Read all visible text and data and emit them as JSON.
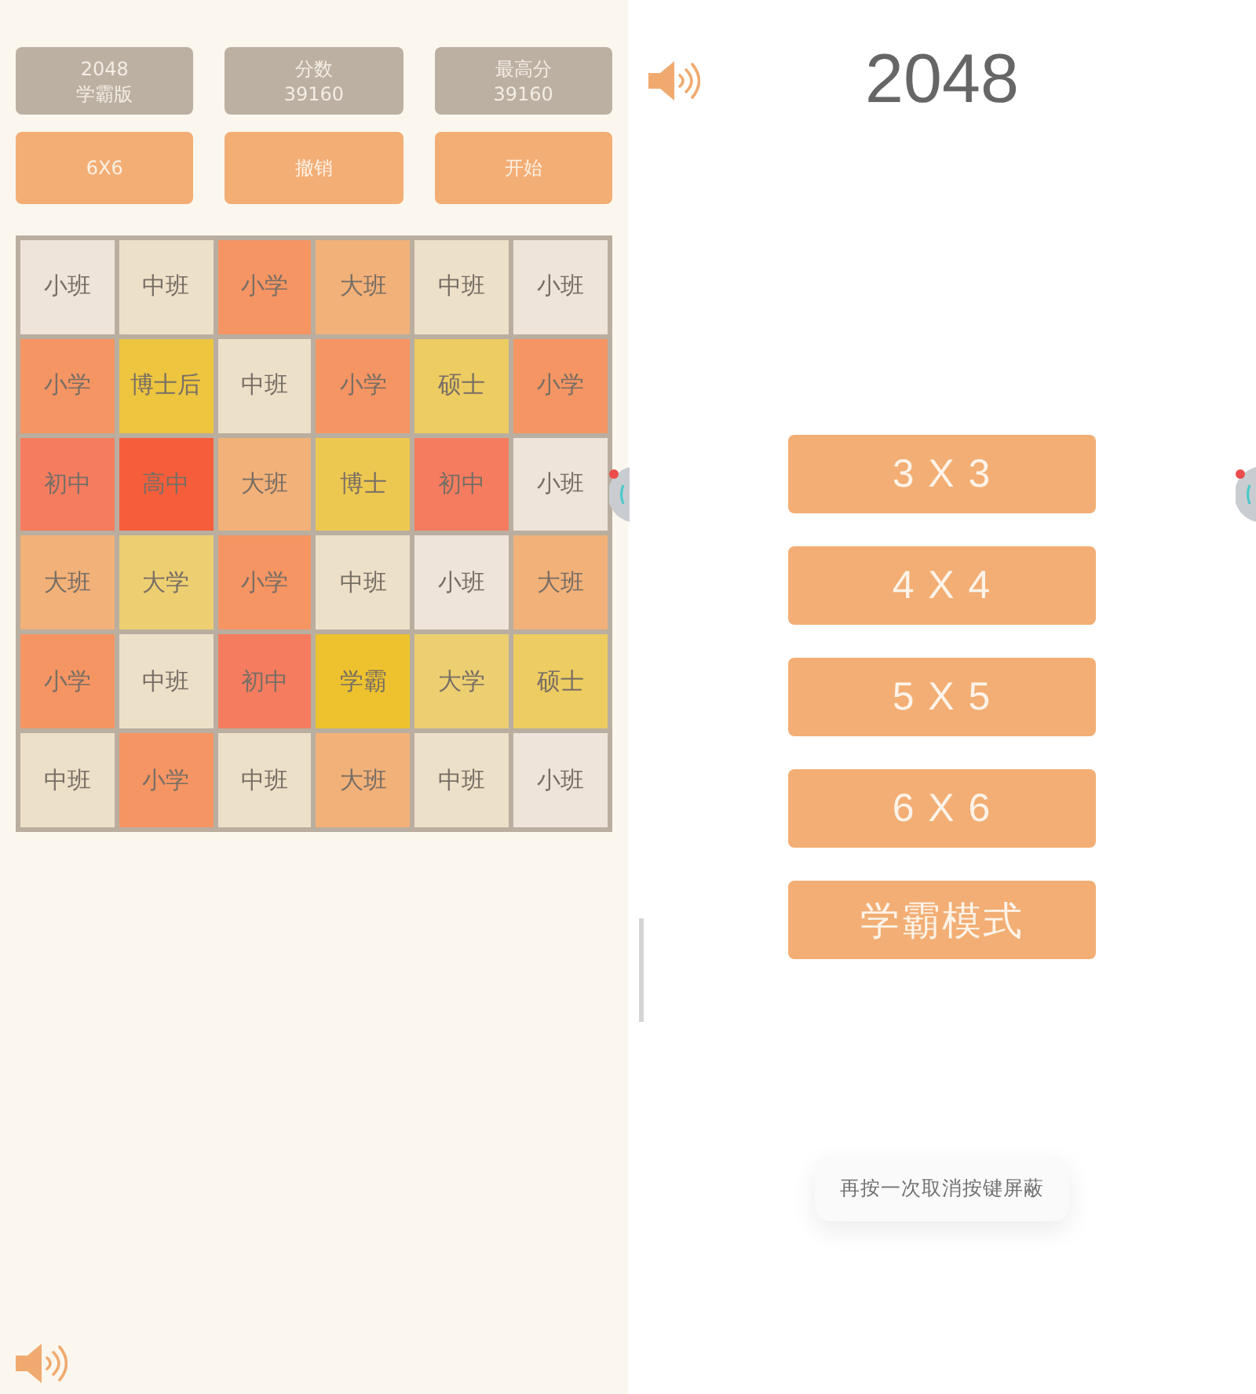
{
  "game_screen": {
    "info_boxes": [
      {
        "label": "2048",
        "value": "学霸版"
      },
      {
        "label": "分数",
        "value": "39160"
      },
      {
        "label": "最高分",
        "value": "39160"
      }
    ],
    "buttons": [
      "6X6",
      "撤销",
      "开始"
    ],
    "board": {
      "rows": [
        [
          {
            "text": "小班",
            "color": "#eee4da"
          },
          {
            "text": "中班",
            "color": "#ede0c8"
          },
          {
            "text": "小学",
            "color": "#f59563"
          },
          {
            "text": "大班",
            "color": "#f2b179"
          },
          {
            "text": "中班",
            "color": "#ede0c8"
          },
          {
            "text": "小班",
            "color": "#eee4da"
          }
        ],
        [
          {
            "text": "小学",
            "color": "#f59563"
          },
          {
            "text": "博士后",
            "color": "#edc53f"
          },
          {
            "text": "中班",
            "color": "#ede0c8"
          },
          {
            "text": "小学",
            "color": "#f59563"
          },
          {
            "text": "硕士",
            "color": "#edcc61"
          },
          {
            "text": "小学",
            "color": "#f59563"
          }
        ],
        [
          {
            "text": "初中",
            "color": "#f67c5f"
          },
          {
            "text": "高中",
            "color": "#f65e3b"
          },
          {
            "text": "大班",
            "color": "#f2b179"
          },
          {
            "text": "博士",
            "color": "#edc850"
          },
          {
            "text": "初中",
            "color": "#f67c5f"
          },
          {
            "text": "小班",
            "color": "#eee4da"
          }
        ],
        [
          {
            "text": "大班",
            "color": "#f2b179"
          },
          {
            "text": "大学",
            "color": "#edcf72"
          },
          {
            "text": "小学",
            "color": "#f59563"
          },
          {
            "text": "中班",
            "color": "#ede0c8"
          },
          {
            "text": "小班",
            "color": "#eee4da"
          },
          {
            "text": "大班",
            "color": "#f2b179"
          }
        ],
        [
          {
            "text": "小学",
            "color": "#f59563"
          },
          {
            "text": "中班",
            "color": "#ede0c8"
          },
          {
            "text": "初中",
            "color": "#f67c5f"
          },
          {
            "text": "学霸",
            "color": "#edc22e"
          },
          {
            "text": "大学",
            "color": "#edcf72"
          },
          {
            "text": "硕士",
            "color": "#edcc61"
          }
        ],
        [
          {
            "text": "中班",
            "color": "#ede0c8"
          },
          {
            "text": "小学",
            "color": "#f59563"
          },
          {
            "text": "中班",
            "color": "#ede0c8"
          },
          {
            "text": "大班",
            "color": "#f2b179"
          },
          {
            "text": "中班",
            "color": "#ede0c8"
          },
          {
            "text": "小班",
            "color": "#eee4da"
          }
        ]
      ]
    }
  },
  "menu_screen": {
    "title": "2048",
    "buttons": [
      "3 X 3",
      "4 X 4",
      "5 X 5",
      "6 X 6",
      "学霸模式"
    ],
    "toast": "再按一次取消按键屏蔽"
  }
}
